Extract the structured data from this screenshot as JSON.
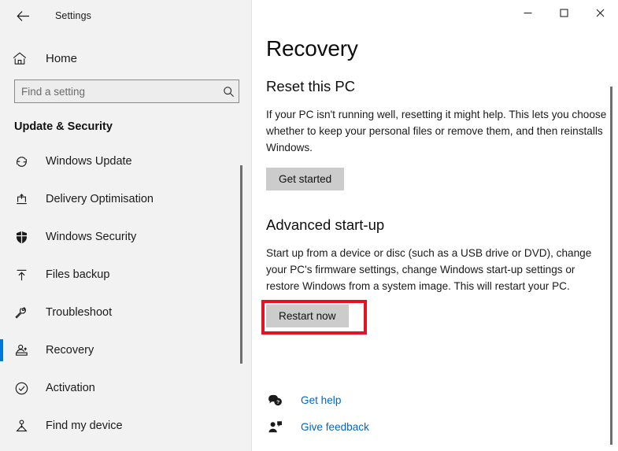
{
  "window": {
    "app_title": "Settings",
    "back_icon": "back-arrow-icon",
    "controls": {
      "minimize": "minimize-icon",
      "maximize": "maximize-icon",
      "close": "close-icon"
    }
  },
  "sidebar": {
    "home": {
      "label": "Home",
      "icon": "home-icon"
    },
    "search": {
      "value": "",
      "placeholder": "Find a setting",
      "icon": "search-icon"
    },
    "category": "Update & Security",
    "items": [
      {
        "label": "Windows Update",
        "icon": "sync-icon",
        "selected": false
      },
      {
        "label": "Delivery Optimisation",
        "icon": "delivery-upload-icon",
        "selected": false
      },
      {
        "label": "Windows Security",
        "icon": "shield-icon",
        "selected": false
      },
      {
        "label": "Files backup",
        "icon": "upload-arrow-icon",
        "selected": false
      },
      {
        "label": "Troubleshoot",
        "icon": "wrench-icon",
        "selected": false
      },
      {
        "label": "Recovery",
        "icon": "recovery-icon",
        "selected": true
      },
      {
        "label": "Activation",
        "icon": "check-circle-icon",
        "selected": false
      },
      {
        "label": "Find my device",
        "icon": "locate-device-icon",
        "selected": false
      }
    ]
  },
  "main": {
    "page_title": "Recovery",
    "reset_section": {
      "heading": "Reset this PC",
      "description": "If your PC isn't running well, resetting it might help. This lets you choose whether to keep your personal files or remove them, and then reinstalls Windows.",
      "button": "Get started"
    },
    "advanced_section": {
      "heading": "Advanced start-up",
      "description": "Start up from a device or disc (such as a USB drive or DVD), change your PC's firmware settings, change Windows start-up settings or restore Windows from a system image. This will restart your PC.",
      "button": "Restart now",
      "highlighted": true
    },
    "links": [
      {
        "label": "Get help",
        "icon": "help-bubble-icon"
      },
      {
        "label": "Give feedback",
        "icon": "feedback-person-icon"
      }
    ]
  },
  "colors": {
    "accent": "#0078d7",
    "link": "#0067c0",
    "annotation": "#e81123",
    "button_face": "#cccccc",
    "sidebar_bg": "#f2f2f2"
  }
}
